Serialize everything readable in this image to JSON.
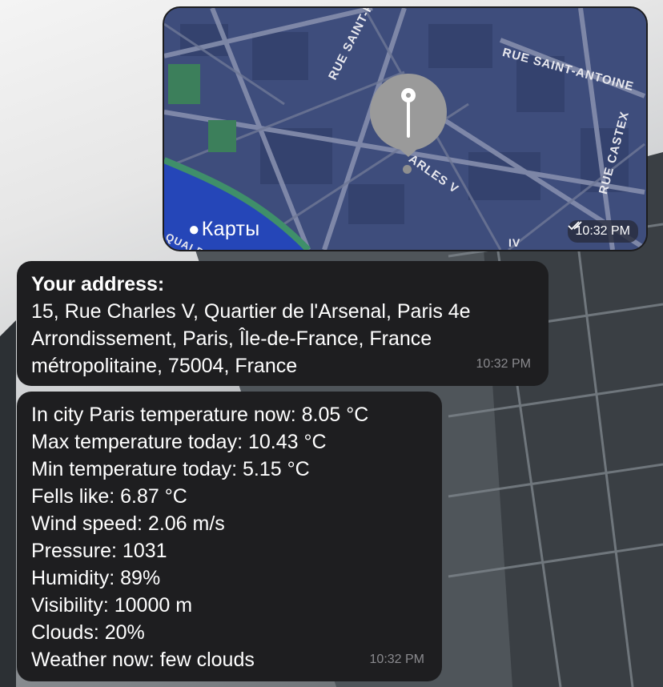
{
  "map_message": {
    "logo_text": "Карты",
    "time": "10:32 PM",
    "streets": {
      "saint_paul": "RUE SAINT-PAUL",
      "saint_antoine": "RUE SAINT-ANTOINE",
      "castex": "RUE CASTEX",
      "charles_v": "ARLES V",
      "quai": "QUAI D",
      "bottom_right": "IV"
    }
  },
  "address_message": {
    "heading": "Your address:",
    "lines": [
      "15, Rue Charles V, Quartier de l'Arsenal, Paris 4e",
      "Arrondissement, Paris, Île-de-France, France",
      "métropolitaine, 75004, France"
    ],
    "time": "10:32 PM"
  },
  "weather_message": {
    "lines": [
      "In city Paris temperature now: 8.05 °C",
      "Max temperature today: 10.43 °C",
      "Min temperature today: 5.15 °C",
      "Fells like: 6.87 °C",
      "Wind speed: 2.06 m/s",
      "Pressure: 1031",
      "Humidity: 89%",
      "Visibility: 10000 m",
      "Clouds: 20%",
      "Weather now: few clouds"
    ],
    "time": "10:32 PM"
  },
  "colors": {
    "bubble": "#1e1e20",
    "map_base": "#3c4b7a",
    "time_text": "#8a8a8e"
  }
}
